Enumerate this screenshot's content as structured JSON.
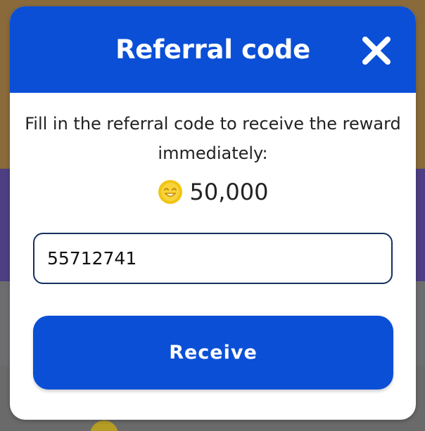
{
  "modal": {
    "title": "Referral code",
    "description": "Fill in the referral code to receive the reward immediately:",
    "reward": {
      "icon": "coin-icon",
      "amount": "50,000"
    },
    "code_input": {
      "value": "55712741",
      "placeholder": ""
    },
    "receive_button_label": "Receive",
    "close_icon": "close-icon"
  },
  "colors": {
    "header_blue": "#0a4fd6",
    "button_blue": "#0a4fd6",
    "input_border": "#14305e",
    "coin_gold": "#f2c313"
  }
}
